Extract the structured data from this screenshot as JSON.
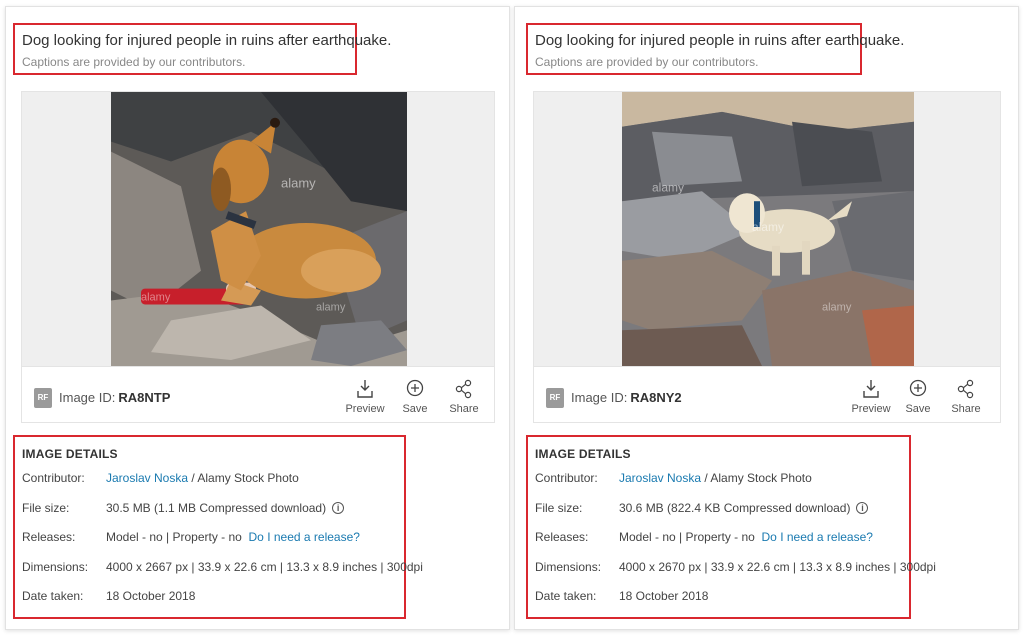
{
  "panels": [
    {
      "caption_title": "Dog looking for injured people in ruins after earthquake.",
      "caption_sub": "Captions are provided by our contributors.",
      "badge": "RF",
      "image_id_label": "Image ID:",
      "image_id": "RA8NTP",
      "actions": {
        "preview": "Preview",
        "save": "Save",
        "share": "Share"
      },
      "details_heading": "IMAGE DETAILS",
      "contributor_label": "Contributor:",
      "contributor_name": "Jaroslav Noska",
      "contributor_suffix": "/ Alamy Stock Photo",
      "file_size_label": "File size:",
      "file_size": "30.5 MB (1.1 MB Compressed download)",
      "releases_label": "Releases:",
      "releases": "Model - no | Property - no",
      "release_link": "Do I need a release?",
      "dimensions_label": "Dimensions:",
      "dimensions": "4000 x 2667 px | 33.9 x 22.6 cm | 13.3 x 8.9 inches | 300dpi",
      "date_label": "Date taken:",
      "date": "18 October 2018",
      "watermark": "alamy"
    },
    {
      "caption_title": "Dog looking for injured people in ruins after earthquake.",
      "caption_sub": "Captions are provided by our contributors.",
      "badge": "RF",
      "image_id_label": "Image ID:",
      "image_id": "RA8NY2",
      "actions": {
        "preview": "Preview",
        "save": "Save",
        "share": "Share"
      },
      "details_heading": "IMAGE DETAILS",
      "contributor_label": "Contributor:",
      "contributor_name": "Jaroslav Noska",
      "contributor_suffix": "/ Alamy Stock Photo",
      "file_size_label": "File size:",
      "file_size": "30.6 MB (822.4 KB Compressed download)",
      "releases_label": "Releases:",
      "releases": "Model - no | Property - no",
      "release_link": "Do I need a release?",
      "dimensions_label": "Dimensions:",
      "dimensions": "4000 x 2670 px | 33.9 x 22.6 cm | 13.3 x 8.9 inches | 300dpi",
      "date_label": "Date taken:",
      "date": "18 October 2018",
      "watermark": "alamy"
    }
  ],
  "colors": {
    "highlight_border": "#d9282f",
    "link": "#1a7ab0",
    "badge_bg": "#9a9a9a",
    "image_bg": "#efefef"
  },
  "icons": [
    "info-icon",
    "preview-icon",
    "save-icon",
    "share-icon"
  ]
}
